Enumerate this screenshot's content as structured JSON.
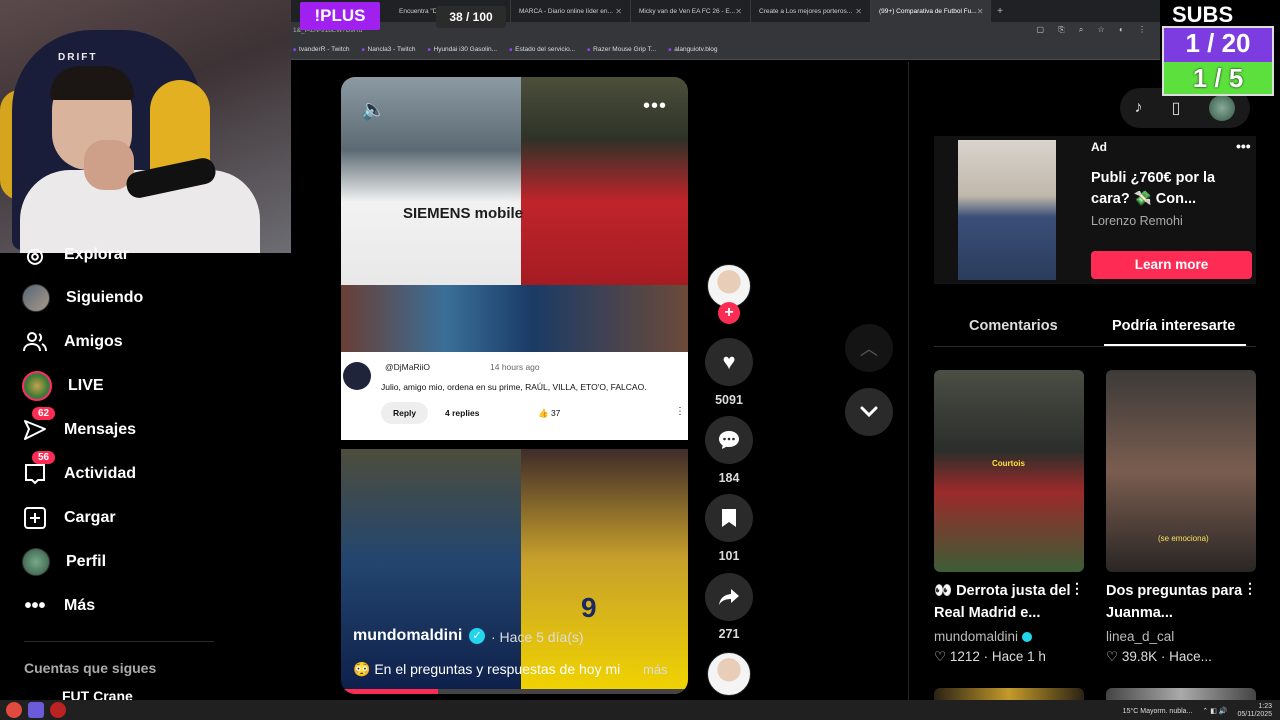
{
  "browser": {
    "tabs": [
      {
        "label": "Encuentra \"DI MARIA O PEPEI...\""
      },
      {
        "label": "MARCA - Diario online líder en..."
      },
      {
        "label": "Micky van de Ven EA FC 26 - E..."
      },
      {
        "label": "Create a Los mejores porteros..."
      },
      {
        "label": "(99+) Comparativa de Futbol Fu..."
      }
    ],
    "url_fragment": "1&_t=ZN-91bEW7B9Ru",
    "bookmarks": [
      "tvanderR - Twitch",
      "Nancla3 - Twitch",
      "Hyundai i30 Gasolin...",
      "Estado del servicio...",
      "Razer Mouse Grip T...",
      "alanguiotv.blog"
    ]
  },
  "stream_overlay": {
    "plus_badge": "!PLUS",
    "counter": "38 / 100",
    "subs_title": "SUBS HOY",
    "subs_count": "1 / 20",
    "subs_goal": "1 / 5"
  },
  "webcam": {
    "chair_brand": "DRIFT"
  },
  "sidebar": {
    "items": [
      {
        "label": "Explorar",
        "icon": "compass-icon"
      },
      {
        "label": "Siguiendo",
        "icon": "following-avatar"
      },
      {
        "label": "Amigos",
        "icon": "friends-icon"
      },
      {
        "label": "LIVE",
        "icon": "live-avatar"
      },
      {
        "label": "Mensajes",
        "icon": "messages-icon",
        "badge": "62"
      },
      {
        "label": "Actividad",
        "icon": "activity-icon",
        "badge": "56"
      },
      {
        "label": "Cargar",
        "icon": "upload-icon"
      },
      {
        "label": "Perfil",
        "icon": "profile-avatar"
      },
      {
        "label": "Más",
        "icon": "more-icon"
      }
    ],
    "following_title": "Cuentas que sigues",
    "following_first": "FUT Crane"
  },
  "video": {
    "comment": {
      "user": "@DjMaRiiO",
      "time": "14 hours ago",
      "text": "Julio, amigo mio, ordena en su prime, RAÚL, VILLA, ETO'O, FALCAO.",
      "reply_label": "Reply",
      "replies": "4 replies",
      "likes": "37"
    },
    "sponsor_text": "SIEMENS mobile",
    "jersey_number": "9",
    "author": "mundomaldini",
    "posted": "· Hace 5 día(s)",
    "description": "😳 En el preguntas y respuestas de hoy mi",
    "more": "más",
    "progress": 0.28
  },
  "actions": {
    "likes": "5091",
    "comments": "184",
    "saves": "101",
    "shares": "271"
  },
  "ad": {
    "label": "Ad",
    "title": "Publi ¿760€ por la cara? 💸 Con...",
    "brand": "Lorenzo Remohi",
    "cta": "Learn more"
  },
  "tabs": {
    "comments": "Comentarios",
    "interest": "Podría interesarte"
  },
  "recommendations": [
    {
      "caption": "Courtois",
      "title": "👀 Derrota justa del Real Madrid e...",
      "author": "mundomaldini",
      "likes": "1212",
      "time": "Hace 1 h"
    },
    {
      "caption": "(se emociona)",
      "title": "Dos preguntas para Juanma...",
      "author": "linea_d_cal",
      "likes": "39.8K",
      "time": "Hace..."
    }
  ],
  "taskbar": {
    "weather": "15°C  Mayorm. nubla...",
    "time": "1:23",
    "date": "05/11/2025"
  },
  "colors": {
    "accent": "#fe2c55",
    "verified": "#20d5ec",
    "plus": "#a020f0",
    "subs_box": "#7d3ce0",
    "subs_goal": "#5ce03d"
  }
}
